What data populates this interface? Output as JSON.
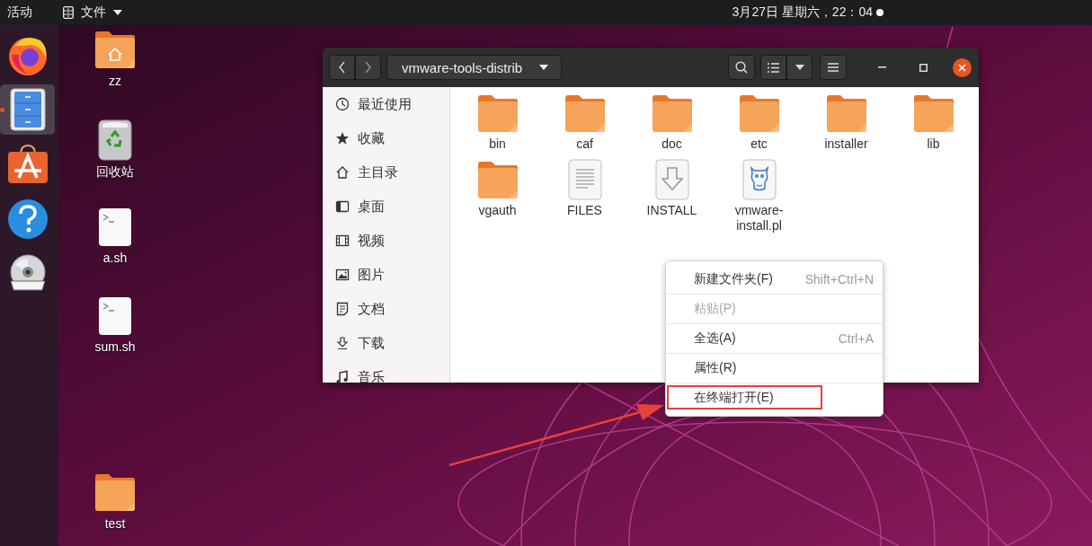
{
  "top_bar": {
    "activities": "活动",
    "app_menu": "文件",
    "clock": "3月27日 星期六，22：04"
  },
  "dock": [
    {
      "kind": "browser",
      "selected": false,
      "running": false
    },
    {
      "kind": "files",
      "selected": true,
      "running": true
    },
    {
      "kind": "software",
      "selected": false,
      "running": false
    },
    {
      "kind": "help",
      "selected": false,
      "running": false
    },
    {
      "kind": "disc",
      "selected": false,
      "running": false
    }
  ],
  "desktop_icons": [
    {
      "label": "zz",
      "kind": "home"
    },
    {
      "label": "回收站",
      "kind": "trash"
    },
    {
      "label": "a.sh",
      "kind": "script"
    },
    {
      "label": "sum.sh",
      "kind": "script"
    },
    {
      "label": "test",
      "kind": "folder"
    }
  ],
  "window": {
    "path": "vmware-tools-distrib",
    "sidebar": [
      {
        "label": "最近使用",
        "kind": "recent"
      },
      {
        "label": "收藏",
        "kind": "starred"
      },
      {
        "label": "主目录",
        "kind": "home"
      },
      {
        "label": "桌面",
        "kind": "desktop"
      },
      {
        "label": "视频",
        "kind": "videos"
      },
      {
        "label": "图片",
        "kind": "pictures"
      },
      {
        "label": "文档",
        "kind": "documents"
      },
      {
        "label": "下载",
        "kind": "downloads"
      },
      {
        "label": "音乐",
        "kind": "music"
      }
    ],
    "files": [
      {
        "name": "bin",
        "kind": "folder"
      },
      {
        "name": "caf",
        "kind": "folder"
      },
      {
        "name": "doc",
        "kind": "folder"
      },
      {
        "name": "etc",
        "kind": "folder"
      },
      {
        "name": "installer",
        "kind": "folder"
      },
      {
        "name": "lib",
        "kind": "folder"
      },
      {
        "name": "vgauth",
        "kind": "folder"
      },
      {
        "name": "FILES",
        "kind": "text"
      },
      {
        "name": "INSTALL",
        "kind": "install"
      },
      {
        "name": "vmware-install.pl",
        "kind": "perl"
      }
    ]
  },
  "context_menu": [
    {
      "label": "新建文件夹(F)",
      "shortcut": "Shift+Ctrl+N",
      "disabled": false,
      "marked": false
    },
    {
      "label": "粘贴(P)",
      "disabled": true,
      "marked": false
    },
    {
      "label": "全选(A)",
      "shortcut": "Ctrl+A",
      "disabled": false,
      "marked": false
    },
    {
      "label": "属性(R)",
      "disabled": false,
      "marked": false
    },
    {
      "label": "在终端打开(E)",
      "disabled": false,
      "marked": true
    }
  ],
  "callout_arrow": true
}
